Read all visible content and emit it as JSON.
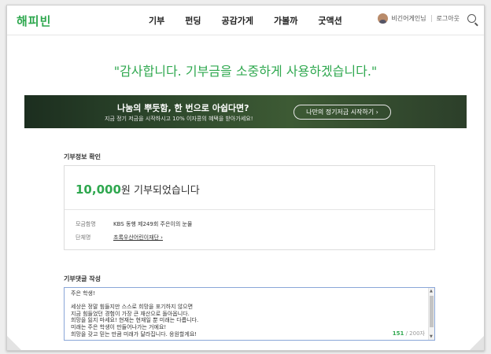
{
  "header": {
    "logo": "해피빈",
    "nav": [
      "기부",
      "펀딩",
      "공감가게",
      "가볼까",
      "굿액션"
    ],
    "user_name": "비긴어게인님",
    "logout": "로그아웃"
  },
  "thanks_message": "\"감사합니다. 기부금을 소중하게 사용하겠습니다.\"",
  "banner": {
    "title": "나눔의 뿌듯함, 한 번으로 아쉽다면?",
    "subtitle": "지금 정기 저금을 시작하시고 10% 이자콩의 혜택을 받아가세요!",
    "button_label": "나만의 정기저금 시작하기 ›"
  },
  "donation_info": {
    "section_title": "기부정보 확인",
    "amount_number": "10,000",
    "amount_suffix": "원 기부되었습니다",
    "fundraiser_label": "모금함명",
    "fundraiser_value": "KBS 동행 제249회 주은이의 눈물",
    "org_label": "단체명",
    "org_value": "초록우산어린이재단 ›"
  },
  "comment": {
    "section_title": "기부댓글 작성",
    "text": "주은 학생!\n\n세상은 정말 힘들지만 스스로 희망을 포기하지 않으면\n지금 힘들었던 경험이 가장 큰 재산으로 돌아옵니다.\n희망을 잃지 마세요! 현재는 현재일 뿐 미래는 다릅니다.\n미래는 주은 학생이 만들어나가는 거에요!\n희망을 갖고 믿는 만큼 미래가 달라집니다. 응원할게요!",
    "count_current": "151",
    "count_max": " / 200자"
  },
  "colors": {
    "accent": "#2fa84f",
    "banner_dark": "#2f4a2d"
  }
}
